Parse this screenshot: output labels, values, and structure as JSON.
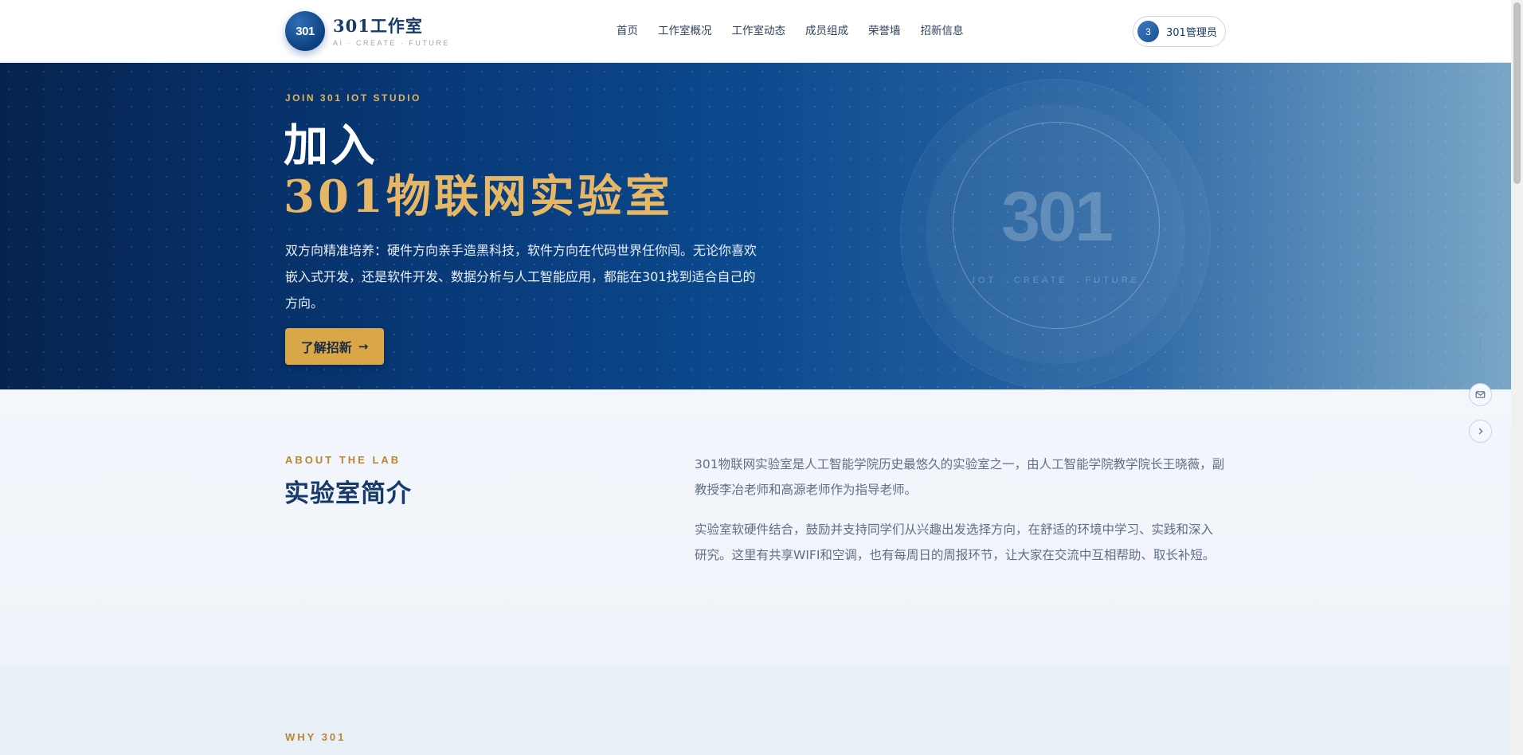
{
  "brand": {
    "logo_text": "301",
    "name": "301工作室",
    "subtitle": "AI · CREATE · FUTURE"
  },
  "nav": {
    "items": [
      "首页",
      "工作室概况",
      "工作室动态",
      "成员组成",
      "荣誉墙",
      "招新信息"
    ]
  },
  "admin": {
    "avatar_text": "3",
    "name": "301管理员"
  },
  "hero": {
    "kicker": "JOIN 301 IOT STUDIO",
    "title_line1": "加入",
    "title_line2": "301物联网实验室",
    "description": "双方向精准培养：硬件方向亲手造黑科技，软件方向在代码世界任你闯。无论你喜欢嵌入式开发，还是软件开发、数据分析与人工智能应用，都能在301找到适合自己的方向。",
    "button_label": "了解招新",
    "button_arrow": "→",
    "emblem_number": "301",
    "emblem_subtitle": "IOT · CREATE · FUTURE"
  },
  "about": {
    "kicker": "ABOUT THE LAB",
    "title": "实验室简介",
    "paragraphs": [
      "301物联网实验室是人工智能学院历史最悠久的实验室之一，由人工智能学院教学院长王晓薇，副教授李冶老师和高源老师作为指导老师。",
      "实验室软硬件结合，鼓励并支持同学们从兴趣出发选择方向，在舒适的环境中学习、实践和深入研究。这里有共享WIFI和空调，也有每周日的周报环节，让大家在交流中互相帮助、取长补短。"
    ]
  },
  "why": {
    "kicker": "WHY 301"
  },
  "side": {
    "label": "301 STUDIO"
  },
  "colors": {
    "accent_gold": "#d9a748",
    "brand_navy": "#163a6b",
    "hero_dark": "#06234f"
  }
}
